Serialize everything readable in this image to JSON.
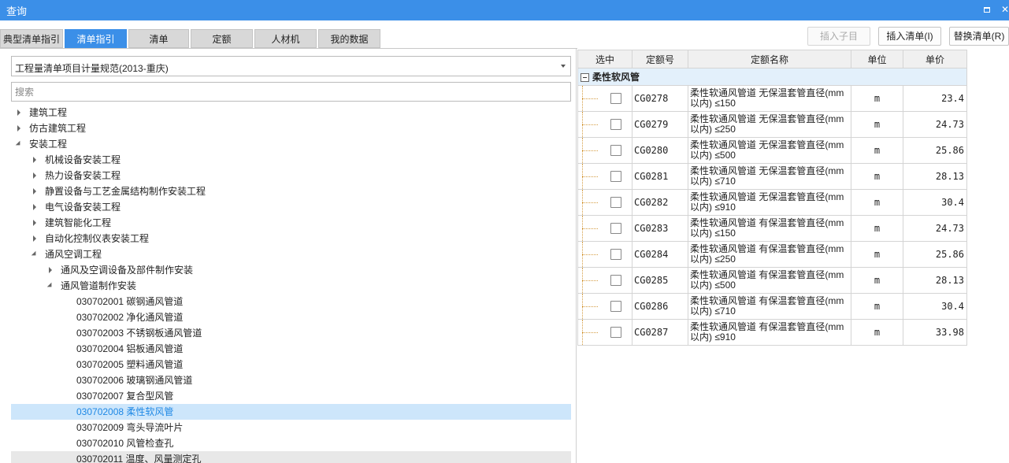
{
  "window": {
    "title": "查询",
    "close_glyph": "✕"
  },
  "tabs": [
    {
      "label": "典型清单指引",
      "active": false
    },
    {
      "label": "清单指引",
      "active": true
    },
    {
      "label": "清单",
      "active": false
    },
    {
      "label": "定额",
      "active": false
    },
    {
      "label": "人材机",
      "active": false
    },
    {
      "label": "我的数据",
      "active": false
    }
  ],
  "actions": {
    "insert_child": "插入子目",
    "insert_list": "插入清单(I)",
    "replace_list": "替换清单(R)"
  },
  "spec_select": {
    "value": "工程量清单项目计量规范(2013-重庆)"
  },
  "search": {
    "placeholder": "搜索"
  },
  "tree": [
    {
      "label": "建筑工程",
      "depth": 0,
      "toggle": "collapsed"
    },
    {
      "label": "仿古建筑工程",
      "depth": 0,
      "toggle": "collapsed"
    },
    {
      "label": "安装工程",
      "depth": 0,
      "toggle": "expanded"
    },
    {
      "label": "机械设备安装工程",
      "depth": 1,
      "toggle": "collapsed"
    },
    {
      "label": "热力设备安装工程",
      "depth": 1,
      "toggle": "collapsed"
    },
    {
      "label": "静置设备与工艺金属结构制作安装工程",
      "depth": 1,
      "toggle": "collapsed"
    },
    {
      "label": "电气设备安装工程",
      "depth": 1,
      "toggle": "collapsed"
    },
    {
      "label": "建筑智能化工程",
      "depth": 1,
      "toggle": "collapsed"
    },
    {
      "label": "自动化控制仪表安装工程",
      "depth": 1,
      "toggle": "collapsed"
    },
    {
      "label": "通风空调工程",
      "depth": 1,
      "toggle": "expanded"
    },
    {
      "label": "通风及空调设备及部件制作安装",
      "depth": 2,
      "toggle": "collapsed"
    },
    {
      "label": "通风管道制作安装",
      "depth": 2,
      "toggle": "expanded"
    },
    {
      "label": "030702001  碳钢通风管道",
      "depth": 3,
      "toggle": "none"
    },
    {
      "label": "030702002  净化通风管道",
      "depth": 3,
      "toggle": "none"
    },
    {
      "label": "030702003  不锈钢板通风管道",
      "depth": 3,
      "toggle": "none"
    },
    {
      "label": "030702004  铝板通风管道",
      "depth": 3,
      "toggle": "none"
    },
    {
      "label": "030702005  塑料通风管道",
      "depth": 3,
      "toggle": "none"
    },
    {
      "label": "030702006  玻璃钢通风管道",
      "depth": 3,
      "toggle": "none"
    },
    {
      "label": "030702007  复合型风管",
      "depth": 3,
      "toggle": "none"
    },
    {
      "label": "030702008  柔性软风管",
      "depth": 3,
      "toggle": "none",
      "selected": true
    },
    {
      "label": "030702009  弯头导流叶片",
      "depth": 3,
      "toggle": "none"
    },
    {
      "label": "030702010  风管检查孔",
      "depth": 3,
      "toggle": "none"
    },
    {
      "label": "030702011  温度、风量测定孔",
      "depth": 3,
      "toggle": "none",
      "hover": true
    }
  ],
  "grid": {
    "columns": [
      "选中",
      "定额号",
      "定额名称",
      "单位",
      "单价"
    ],
    "group_label": "柔性软风管",
    "rows": [
      {
        "code": "CG0278",
        "name": "柔性软通风管道 无保温套管直径(mm以内) ≤150",
        "unit": "m",
        "price": "23.4"
      },
      {
        "code": "CG0279",
        "name": "柔性软通风管道 无保温套管直径(mm以内) ≤250",
        "unit": "m",
        "price": "24.73"
      },
      {
        "code": "CG0280",
        "name": "柔性软通风管道 无保温套管直径(mm以内) ≤500",
        "unit": "m",
        "price": "25.86"
      },
      {
        "code": "CG0281",
        "name": "柔性软通风管道 无保温套管直径(mm以内) ≤710",
        "unit": "m",
        "price": "28.13"
      },
      {
        "code": "CG0282",
        "name": "柔性软通风管道 无保温套管直径(mm以内) ≤910",
        "unit": "m",
        "price": "30.4"
      },
      {
        "code": "CG0283",
        "name": "柔性软通风管道 有保温套管直径(mm以内) ≤150",
        "unit": "m",
        "price": "24.73"
      },
      {
        "code": "CG0284",
        "name": "柔性软通风管道 有保温套管直径(mm以内) ≤250",
        "unit": "m",
        "price": "25.86"
      },
      {
        "code": "CG0285",
        "name": "柔性软通风管道 有保温套管直径(mm以内) ≤500",
        "unit": "m",
        "price": "28.13"
      },
      {
        "code": "CG0286",
        "name": "柔性软通风管道 有保温套管直径(mm以内) ≤710",
        "unit": "m",
        "price": "30.4"
      },
      {
        "code": "CG0287",
        "name": "柔性软通风管道 有保温套管直径(mm以内) ≤910",
        "unit": "m",
        "price": "33.98"
      }
    ]
  },
  "colors": {
    "accent": "#3b8fe8",
    "selected_row_bg": "#cde6fb",
    "selected_text": "#1e88e5",
    "group_bg": "#e3f0fb"
  }
}
